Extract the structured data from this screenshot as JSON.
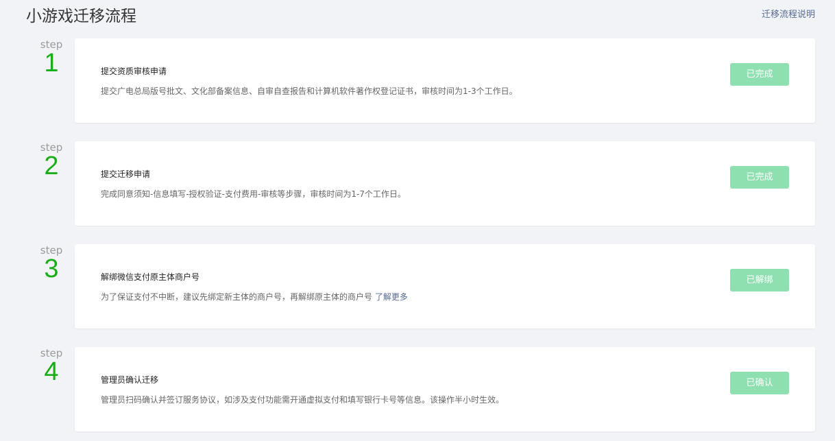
{
  "header": {
    "title": "小游戏迁移流程",
    "help_link": "迁移流程说明"
  },
  "steps": [
    {
      "label": "step",
      "number": "1",
      "title": "提交资质审核申请",
      "description": "提交广电总局版号批文、文化部备案信息、自审自查报告和计算机软件著作权登记证书，审核时间为1-3个工作日。",
      "link": "",
      "status": "已完成"
    },
    {
      "label": "step",
      "number": "2",
      "title": "提交迁移申请",
      "description": "完成同意须知-信息填写-授权验证-支付费用-审核等步骤，审核时间为1-7个工作日。",
      "link": "",
      "status": "已完成"
    },
    {
      "label": "step",
      "number": "3",
      "title": "解绑微信支付原主体商户号",
      "description": "为了保证支付不中断，建议先绑定新主体的商户号，再解绑原主体的商户号",
      "link": "了解更多",
      "status": "已解绑"
    },
    {
      "label": "step",
      "number": "4",
      "title": "管理员确认迁移",
      "description": "管理员扫码确认并签订服务协议，如涉及支付功能需开通虚拟支付和填写银行卡号等信息。该操作半小时生效。",
      "link": "",
      "status": "已确认"
    }
  ],
  "colors": {
    "step_number": "#1aad19",
    "status_button": "#8ee0b0",
    "link": "#576b95"
  }
}
